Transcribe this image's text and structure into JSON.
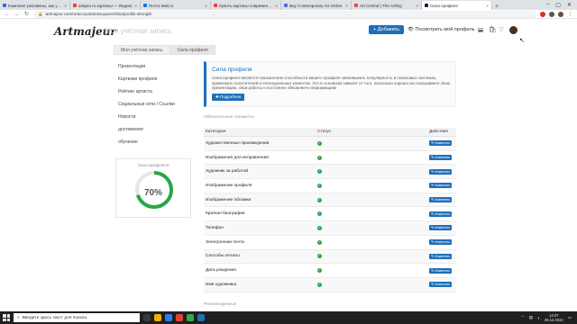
{
  "browser": {
    "tabs": [
      {
        "label": "Комплект рекламны, как устан",
        "color": "#2d6cdf",
        "active": false
      },
      {
        "label": "arlapro.ru картины — Яндекс",
        "color": "#e8422f",
        "active": false
      },
      {
        "label": "Почта Mail.ru",
        "color": "#1a73e8",
        "active": false
      },
      {
        "label": "Купить картины современных",
        "color": "#e8422f",
        "active": false
      },
      {
        "label": "Buy Contemporary Art Online",
        "color": "#4a6fd8",
        "active": false
      },
      {
        "label": "Art Central | The Artling",
        "color": "#e0494a",
        "active": false
      },
      {
        "label": "Сила профиля",
        "color": "#222222",
        "active": true
      }
    ],
    "url": "artmajeur.com/ru/account/anna-gusechkina/profile-strength"
  },
  "header": {
    "logo": "Artmajeur",
    "title": "Моя учётная запись",
    "add_label": "+ Добавить",
    "view_profile_label": "Посмотреть мой профиль",
    "accent": "#1e6fb8"
  },
  "breadcrumb": [
    "Моя учётная запись",
    "Сила профиля"
  ],
  "sidebar": {
    "items": [
      {
        "label": "Презентация"
      },
      {
        "label": "Картинки профиля"
      },
      {
        "label": "Рейтинг артиста"
      },
      {
        "label": "Социальные сети / Ссылки"
      },
      {
        "label": "Новости"
      },
      {
        "label": "достижения"
      },
      {
        "label": "обучение"
      }
    ],
    "strength": {
      "label": "Сила профиля ▾",
      "percent_text": "70%",
      "percent": 70,
      "color": "#28a745"
    }
  },
  "info": {
    "title": "Сила профиля",
    "text": "Сила профиля является показателем способности вашего профиля завоевывать популярность в поисковых системах, привлекать посетителей и потенциальных клиентов. Это в основном зависит от того, насколько хорошо вы показываете свою презентацию, свои работы и постоянно обновляете информацию!",
    "more_label": "✚ Подробнее"
  },
  "table": {
    "section_label": "Обязательные элементы",
    "headers": [
      "Категория",
      "Статус",
      "Действия"
    ],
    "edit_label": "✎ Изменить",
    "rows": [
      {
        "category": "Художественные произведения"
      },
      {
        "category": "Изображения для исправления"
      },
      {
        "category": "Художник за работой"
      },
      {
        "category": "Изображение профиля"
      },
      {
        "category": "Изображение обложки"
      },
      {
        "category": "Краткая биография"
      },
      {
        "category": "Телефон"
      },
      {
        "category": "Электронная почта"
      },
      {
        "category": "Способы оплаты"
      },
      {
        "category": "Дата рождения"
      },
      {
        "category": "Имя художника"
      }
    ]
  },
  "recommend_label": "Рекомендуемые",
  "taskbar": {
    "search_placeholder": "Введите здесь текст для поиска",
    "time": "14:07",
    "date": "28.12.2022"
  }
}
